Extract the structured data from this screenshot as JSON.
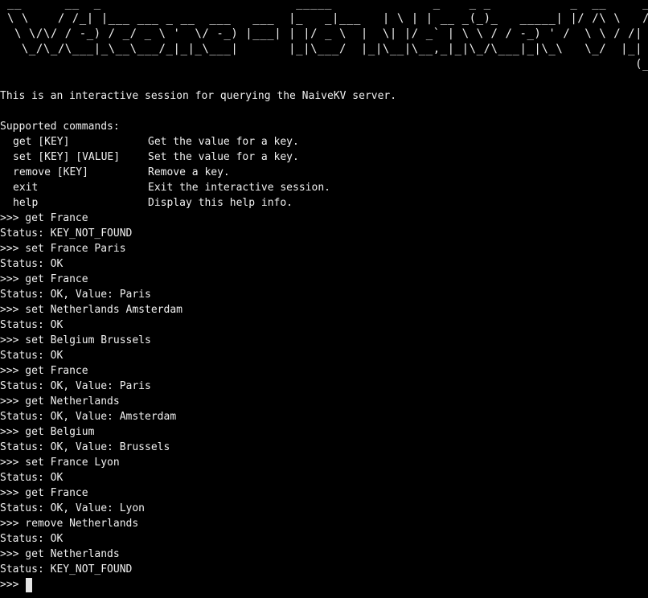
{
  "terminal": {
    "banner": " __      __  _                           _____              _    _ _           _  __     __\n \\ \\    / /_| |___ ___ _ __  ___   ___  |_   _|___   | \\ | | __ _(_)_   _____| |/ /\\ \\   / / |\n  \\ \\/\\/ / -_) / _/ _ \\ '  \\/ -_) |___| | |/ _ \\  |  \\| |/ _` | \\ \\ / / -_) ' /  \\ \\ / /| |\n   \\_/\\_/\\___|_\\__\\___/_|_|_\\___|       |_|\\___/  |_|\\__|\\__,_|_|\\_/\\___|_|\\_\\   \\_/  |_|\n                                                                                        (_)",
    "intro": "This is an interactive session for querying the NaiveKV server.",
    "commands_header": "Supported commands:",
    "commands": [
      {
        "name": "get [KEY]",
        "desc": "Get the value for a key."
      },
      {
        "name": "set [KEY] [VALUE]",
        "desc": "Set the value for a key."
      },
      {
        "name": "remove [KEY]",
        "desc": "Remove a key."
      },
      {
        "name": "exit",
        "desc": "Exit the interactive session."
      },
      {
        "name": "help",
        "desc": "Display this help info."
      }
    ],
    "prompt": ">>> ",
    "history": [
      ">>> get France",
      "Status: KEY_NOT_FOUND",
      ">>> set France Paris",
      "Status: OK",
      ">>> get France",
      "Status: OK, Value: Paris",
      ">>> set Netherlands Amsterdam",
      "Status: OK",
      ">>> set Belgium Brussels",
      "Status: OK",
      ">>> get France",
      "Status: OK, Value: Paris",
      ">>> get Netherlands",
      "Status: OK, Value: Amsterdam",
      ">>> get Belgium",
      "Status: OK, Value: Brussels",
      ">>> set France Lyon",
      "Status: OK",
      ">>> get France",
      "Status: OK, Value: Lyon",
      ">>> remove Netherlands",
      "Status: OK",
      ">>> get Netherlands",
      "Status: KEY_NOT_FOUND"
    ],
    "colors": {
      "background": "#000000",
      "foreground": "#f0f0f0",
      "cursor": "#e6e6e6"
    }
  }
}
